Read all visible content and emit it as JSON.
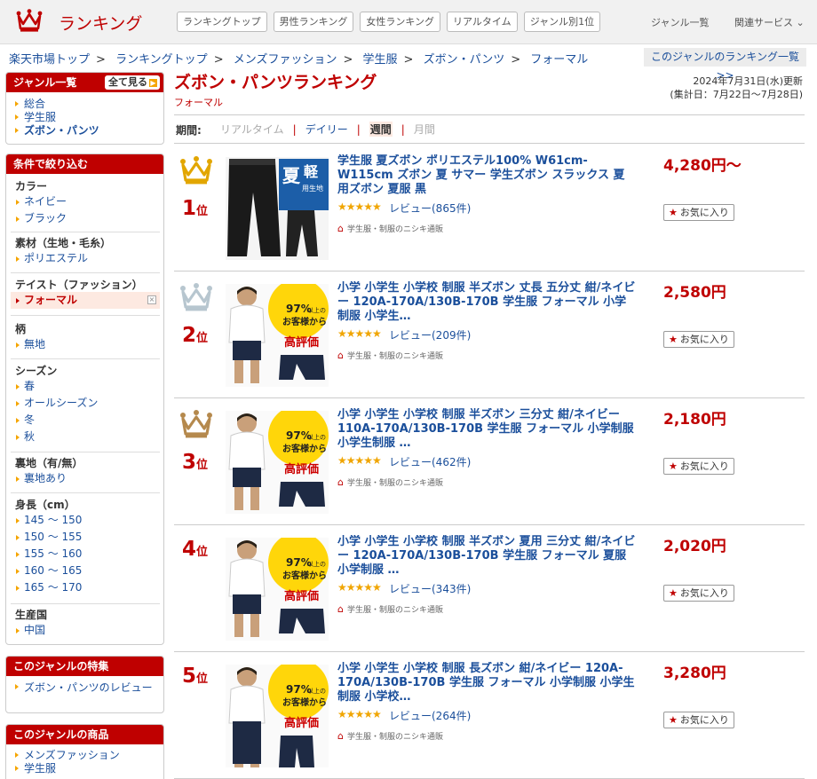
{
  "header": {
    "logo_text": "ランキング",
    "nav_tabs": [
      "ランキングトップ",
      "男性ランキング",
      "女性ランキング",
      "リアルタイム",
      "ジャンル別1位"
    ],
    "genre_list_link": "ジャンル一覧",
    "related_services": "関連サービス ⌄"
  },
  "breadcrumb": [
    "楽天市場トップ",
    "ランキングトップ",
    "メンズファッション",
    "学生服",
    "ズボン・パンツ",
    "フォーマル"
  ],
  "genre_ranking_link": "このジャンルのランキング一覧 >>",
  "sidebar": {
    "genre_box": {
      "title": "ジャンル一覧",
      "see_all": "全て見る",
      "items": [
        "総合",
        "学生服",
        "ズボン・パンツ"
      ]
    },
    "filter_box": {
      "title": "条件で絞り込む",
      "groups": [
        {
          "title": "カラー",
          "items": [
            "ネイビー",
            "ブラック"
          ]
        },
        {
          "title": "素材（生地・毛糸）",
          "items": [
            "ポリエステル"
          ]
        },
        {
          "title": "テイスト（ファッション）",
          "items": [
            "フォーマル"
          ]
        },
        {
          "title": "柄",
          "items": [
            "無地"
          ]
        },
        {
          "title": "シーズン",
          "items": [
            "春",
            "オールシーズン",
            "冬",
            "秋"
          ]
        },
        {
          "title": "裏地（有/無）",
          "items": [
            "裏地あり"
          ]
        },
        {
          "title": "身長（cm）",
          "items": [
            "145 ～ 150",
            "150 ～ 155",
            "155 ～ 160",
            "160 ～ 165",
            "165 ～ 170"
          ]
        },
        {
          "title": "生産国",
          "items": [
            "中国"
          ]
        }
      ],
      "remove_icon": "×"
    },
    "feature_box": {
      "title": "このジャンルの特集",
      "items": [
        "ズボン・パンツのレビュー"
      ]
    },
    "products_box": {
      "title": "このジャンルの商品",
      "items": [
        "メンズファッション",
        "学生服"
      ]
    }
  },
  "main": {
    "title": "ズボン・パンツランキング",
    "subtitle": "フォーマル",
    "updated_line1": "2024年7月31日(水)更新",
    "updated_line2": "(集計日：7月22日～7月28日)",
    "period_label": "期間:",
    "periods": [
      "リアルタイム",
      "デイリー",
      "週間",
      "月間"
    ],
    "period_separator": "|"
  },
  "rankings": [
    {
      "rank": "1",
      "rank_suffix": "位",
      "title": "学生服 夏ズボン ポリエステル100% W61cm-W115cm ズボン 夏 サマー 学生ズボン スラックス 夏用ズボン 夏服 黒",
      "stars": "★★★★★",
      "review": "レビュー(865件)",
      "shop": "学生服・制服のニシキ通販",
      "price": "4,280円～",
      "fav": "お気に入り"
    },
    {
      "rank": "2",
      "rank_suffix": "位",
      "title": "小学 小学生 小学校 制服 半ズボン 丈長 五分丈 紺/ネイビー 120A-170A/130B-170B 学生服 フォーマル 小学制服 小学生…",
      "stars": "★★★★★",
      "review": "レビュー(209件)",
      "shop": "学生服・制服のニシキ通販",
      "price": "2,580円",
      "fav": "お気に入り"
    },
    {
      "rank": "3",
      "rank_suffix": "位",
      "title": "小学 小学生 小学校 制服 半ズボン 三分丈 紺/ネイビー 110A-170A/130B-170B 学生服 フォーマル 小学制服 小学生制服 …",
      "stars": "★★★★★",
      "review": "レビュー(462件)",
      "shop": "学生服・制服のニシキ通販",
      "price": "2,180円",
      "fav": "お気に入り"
    },
    {
      "rank": "4",
      "rank_suffix": "位",
      "title": "小学 小学生 小学校 制服 半ズボン 夏用 三分丈 紺/ネイビー 120A-170A/130B-170B 学生服 フォーマル 夏服 小学制服 …",
      "stars": "★★★★★",
      "review": "レビュー(343件)",
      "shop": "学生服・制服のニシキ通販",
      "price": "2,020円",
      "fav": "お気に入り"
    },
    {
      "rank": "5",
      "rank_suffix": "位",
      "title": "小学 小学生 小学校 制服 長ズボン 紺/ネイビー 120A-170A/130B-170B 学生服 フォーマル 小学制服 小学生制服 小学校…",
      "stars": "★★★★★",
      "review": "レビュー(264件)",
      "shop": "学生服・制服のニシキ通販",
      "price": "3,280円",
      "fav": "お気に入り"
    }
  ],
  "thumb_text": {
    "summer_big": "夏",
    "summer_light": "軽",
    "summer_tag": "用生地",
    "rating_pct": "97%",
    "rating_line1": "以上の",
    "rating_line2": "お客様から",
    "rating_line3": "高評価"
  },
  "icons": {
    "logo": "crown-icon",
    "home": "home-icon",
    "star": "star-icon",
    "arrow": "chevron-right-icon"
  },
  "colors": {
    "brand": "#bf0000",
    "link": "#1b4f9b",
    "accent": "#f5a500",
    "gold": "#e2a600",
    "silver": "#b7c6cf",
    "bronze": "#b5894d"
  }
}
